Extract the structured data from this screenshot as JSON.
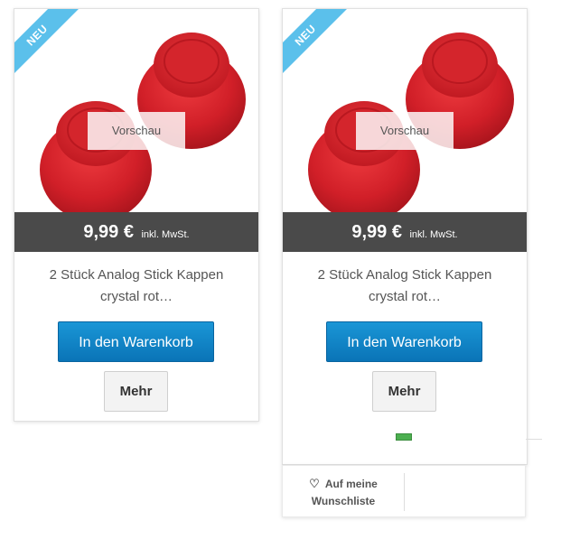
{
  "products": [
    {
      "badge": "NEU",
      "preview_label": "Vorschau",
      "price": "9,99 €",
      "tax_note": "inkl. MwSt.",
      "title_line1": "2 Stück Analog Stick Kappen",
      "title_line2": "crystal rot…",
      "cart_label": "In den Warenkorb",
      "more_label": "Mehr"
    },
    {
      "badge": "NEU",
      "preview_label": "Vorschau",
      "price": "9,99 €",
      "tax_note": "inkl. MwSt.",
      "title_line1": "2 Stück Analog Stick Kappen",
      "title_line2": "crystal rot…",
      "cart_label": "In den Warenkorb",
      "more_label": "Mehr",
      "stock_color": "#4caf50"
    }
  ],
  "wishlist": {
    "icon": "heart-icon",
    "label_line1": "Auf meine",
    "label_line2": "Wunschliste"
  },
  "colors": {
    "badge": "#5bc0eb",
    "price_bar": "#4a4a4a",
    "cart_button": "#0a74b7",
    "product_red": "#d8202a"
  }
}
